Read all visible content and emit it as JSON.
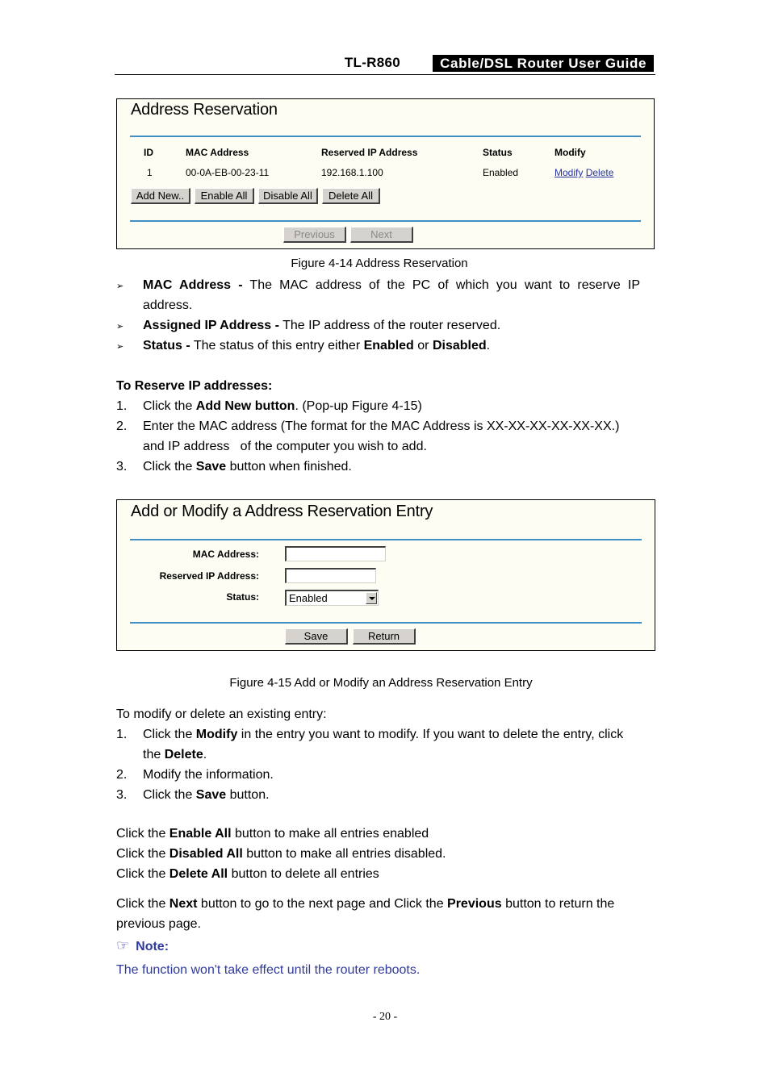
{
  "header": {
    "model": "TL-R860",
    "title": "Cable/DSL Router User Guide"
  },
  "figure14": {
    "title": "Address Reservation",
    "columns": [
      "ID",
      "MAC Address",
      "Reserved IP Address",
      "Status",
      "Modify"
    ],
    "rows": [
      {
        "id": "1",
        "mac": "00-0A-EB-00-23-11",
        "ip": "192.168.1.100",
        "status": "Enabled",
        "modify_link": "Modify",
        "delete_link": "Delete"
      }
    ],
    "buttons": {
      "add_new": "Add New..",
      "enable_all": "Enable All",
      "disable_all": "Disable All",
      "delete_all": "Delete All"
    },
    "nav": {
      "previous": "Previous",
      "next": "Next"
    },
    "caption": "Figure 4-14 Address Reservation",
    "accent_color": "#3d8fc4"
  },
  "descriptions": [
    {
      "term": "MAC Address -",
      "text": " The MAC address of the PC of which you want to reserve IP",
      "cont": "address."
    },
    {
      "term": "Assigned IP Address -",
      "text": " The IP address of the router reserved."
    },
    {
      "term": "Status -",
      "text_parts": [
        " The status of this entry either ",
        "Enabled",
        " or ",
        "Disabled",
        "."
      ]
    }
  ],
  "reserve": {
    "heading": "To Reserve IP addresses:",
    "steps": [
      {
        "n": "1.",
        "pre": "Click the ",
        "bold": "Add New button",
        "post": ". (Pop-up Figure 4-15)"
      },
      {
        "n": "2.",
        "line1": "Enter the MAC address (The format for the MAC Address is XX-XX-XX-XX-XX-XX.)",
        "line2": "and IP address   of the computer you wish to add."
      },
      {
        "n": "3.",
        "pre": "Click the ",
        "bold": "Save",
        "post": " button when finished."
      }
    ]
  },
  "figure15": {
    "title": "Add or Modify a Address Reservation Entry",
    "fields": {
      "mac_label": "MAC Address:",
      "mac_value": "",
      "ip_label": "Reserved IP Address:",
      "ip_value": "",
      "status_label": "Status:",
      "status_value": "Enabled"
    },
    "buttons": {
      "save": "Save",
      "return": "Return"
    },
    "caption": "Figure 4-15 Add or Modify an Address Reservation Entry"
  },
  "modify": {
    "intro": "To modify or delete an existing entry:",
    "steps": [
      {
        "n": "1.",
        "pre": "Click the ",
        "bold": "Modify",
        "post": " in the entry you want to modify. If you want to delete the entry, click",
        "line2_pre": "the ",
        "line2_bold": "Delete",
        "line2_post": "."
      },
      {
        "n": "2.",
        "text": "Modify the information."
      },
      {
        "n": "3.",
        "pre": "Click the ",
        "bold": "Save",
        "post": " button."
      }
    ]
  },
  "bulk": [
    {
      "pre": "Click the ",
      "bold": "Enable All",
      "post": " button to make all entries enabled"
    },
    {
      "pre": "Click the ",
      "bold": "Disabled All",
      "post": " button to make all entries disabled."
    },
    {
      "pre": "Click the ",
      "bold": "Delete All",
      "post": " button to delete all entries"
    }
  ],
  "paging": {
    "pre": "Click the ",
    "bold1": "Next",
    "mid": " button to go to the next page and Click the ",
    "bold2": "Previous",
    "post": " button to return the",
    "line2": "previous page."
  },
  "note": {
    "label": "Note:",
    "icon": "pointing-hand-icon",
    "text": "The function won't take effect until the router reboots.",
    "color": "#2f3a9e"
  },
  "page_number": "- 20 -"
}
